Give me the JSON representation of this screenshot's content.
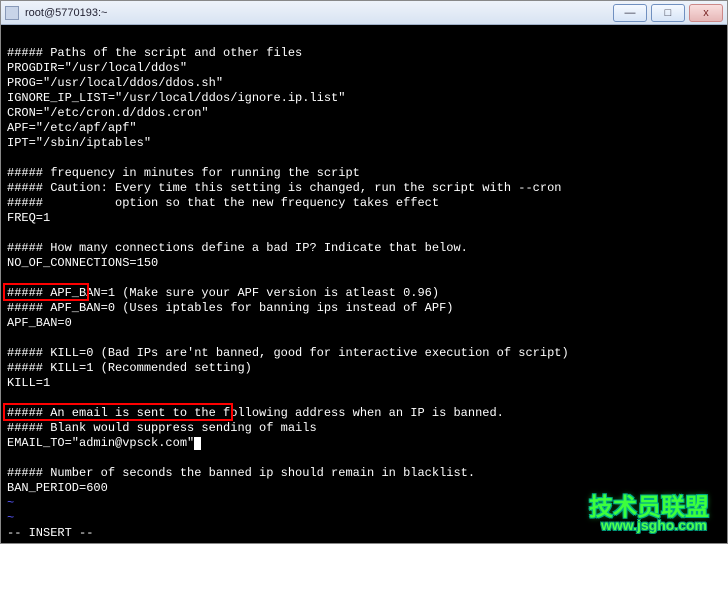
{
  "window": {
    "title": "root@5770193:~"
  },
  "buttons": {
    "minimize": "—",
    "maximize": "□",
    "close": "x"
  },
  "lines": {
    "l1": "##### Paths of the script and other files",
    "l2": "PROGDIR=\"/usr/local/ddos\"",
    "l3": "PROG=\"/usr/local/ddos/ddos.sh\"",
    "l4": "IGNORE_IP_LIST=\"/usr/local/ddos/ignore.ip.list\"",
    "l5": "CRON=\"/etc/cron.d/ddos.cron\"",
    "l6": "APF=\"/etc/apf/apf\"",
    "l7": "IPT=\"/sbin/iptables\"",
    "l8": "",
    "l9": "##### frequency in minutes for running the script",
    "l10": "##### Caution: Every time this setting is changed, run the script with --cron",
    "l11": "#####          option so that the new frequency takes effect",
    "l12": "FREQ=1",
    "l13": "",
    "l14": "##### How many connections define a bad IP? Indicate that below.",
    "l15": "NO_OF_CONNECTIONS=150",
    "l16": "",
    "l17": "##### APF_BAN=1 (Make sure your APF version is atleast 0.96)",
    "l18": "##### APF_BAN=0 (Uses iptables for banning ips instead of APF)",
    "l19": "APF_BAN=0",
    "l20": "",
    "l21": "##### KILL=0 (Bad IPs are'nt banned, good for interactive execution of script)",
    "l22": "##### KILL=1 (Recommended setting)",
    "l23": "KILL=1",
    "l24": "",
    "l25": "##### An email is sent to the following address when an IP is banned.",
    "l26": "##### Blank would suppress sending of mails",
    "l27": "EMAIL_TO=\"admin@vpsck.com\"",
    "l28": "",
    "l29": "##### Number of seconds the banned ip should remain in blacklist.",
    "l30": "BAN_PERIOD=600",
    "t1": "~",
    "t2": "~",
    "status": "-- INSERT --"
  },
  "watermark": {
    "text1": "技术员联盟",
    "text2": "www.jsgho.com"
  }
}
